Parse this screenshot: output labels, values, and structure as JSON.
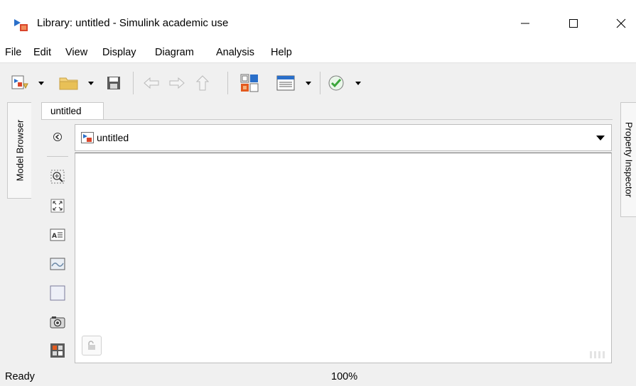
{
  "window": {
    "title": "Library: untitled - Simulink academic use",
    "buttons": {
      "minimize": "minimize",
      "maximize": "maximize",
      "close": "close"
    }
  },
  "menu": [
    "File",
    "Edit",
    "View",
    "Display",
    "Diagram",
    "Analysis",
    "Help"
  ],
  "toolbar": {
    "icons": [
      "new-model-icon",
      "dropdown-icon",
      "open-folder-icon",
      "dropdown-icon",
      "save-icon",
      "back-icon",
      "forward-icon",
      "up-icon",
      "library-browser-icon",
      "model-config-icon",
      "dropdown-icon",
      "check-icon",
      "dropdown-icon"
    ]
  },
  "side_panels": {
    "left": "Model Browser",
    "right": "Property Inspector"
  },
  "tab": {
    "label": "untitled"
  },
  "address": {
    "label": "untitled"
  },
  "palette": {
    "icons": [
      "hide-show-icon",
      "zoom-icon",
      "fit-to-view-icon",
      "annotation-icon",
      "image-icon",
      "area-icon",
      "screenshot-icon",
      "panel-icon"
    ]
  },
  "status": {
    "left": "Ready",
    "zoom": "100%"
  },
  "colors": {
    "accent": "#2a6fc9",
    "check_green": "#3aa63a",
    "folder_yellow": "#e8c057",
    "simulink_red": "#d9452b"
  }
}
